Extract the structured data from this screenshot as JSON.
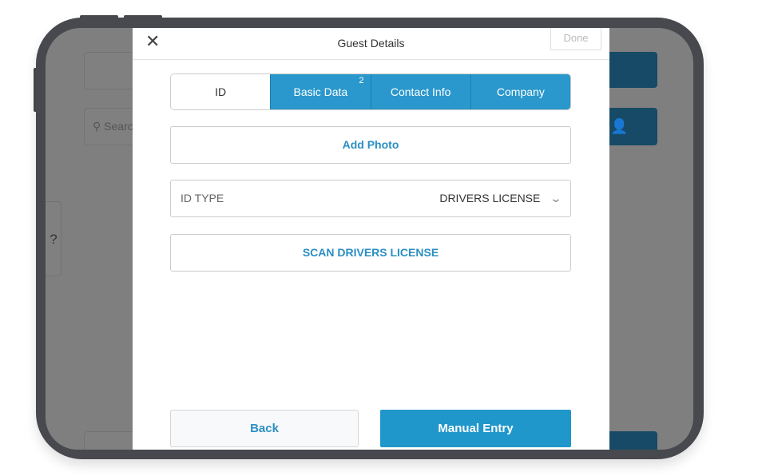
{
  "modal": {
    "title": "Guest Details",
    "done_label": "Done",
    "close_icon": "close-icon"
  },
  "tabs": [
    {
      "label": "ID",
      "active": true
    },
    {
      "label": "Basic Data",
      "badge": "2"
    },
    {
      "label": "Contact Info"
    },
    {
      "label": "Company"
    }
  ],
  "add_photo_label": "Add Photo",
  "id_type": {
    "label": "ID TYPE",
    "value": "DRIVERS LICENSE"
  },
  "scan_label": "SCAN DRIVERS LICENSE",
  "back_label": "Back",
  "manual_entry_label": "Manual Entry",
  "background": {
    "search_placeholder": "Search",
    "help_label": "?"
  },
  "colors": {
    "accent": "#2a98cc",
    "dark_blue": "#164a66",
    "overlay": "#7f7f7f"
  }
}
